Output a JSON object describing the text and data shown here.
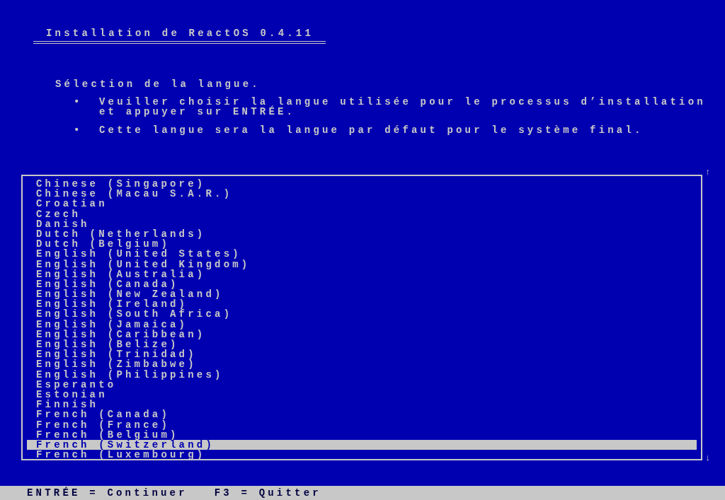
{
  "title": "Installation de ReactOS 0.4.11",
  "heading": "Sélection de la langue.",
  "bullets": [
    {
      "marker": "•",
      "text": "Veuiller choisir la langue utilisée pour le processus d’installation et appuyer sur ENTRÉE."
    },
    {
      "marker": "•",
      "text": "Cette langue sera la langue par défaut pour le système final."
    }
  ],
  "scroll_up": "↑",
  "scroll_down": "↓",
  "languages": [
    {
      "label": "Chinese (Singapore)",
      "selected": false
    },
    {
      "label": "Chinese (Macau S.A.R.)",
      "selected": false
    },
    {
      "label": "Croatian",
      "selected": false
    },
    {
      "label": "Czech",
      "selected": false
    },
    {
      "label": "Danish",
      "selected": false
    },
    {
      "label": "Dutch (Netherlands)",
      "selected": false
    },
    {
      "label": "Dutch (Belgium)",
      "selected": false
    },
    {
      "label": "English (United States)",
      "selected": false
    },
    {
      "label": "English (United Kingdom)",
      "selected": false
    },
    {
      "label": "English (Australia)",
      "selected": false
    },
    {
      "label": "English (Canada)",
      "selected": false
    },
    {
      "label": "English (New Zealand)",
      "selected": false
    },
    {
      "label": "English (Ireland)",
      "selected": false
    },
    {
      "label": "English (South Africa)",
      "selected": false
    },
    {
      "label": "English (Jamaica)",
      "selected": false
    },
    {
      "label": "English (Caribbean)",
      "selected": false
    },
    {
      "label": "English (Belize)",
      "selected": false
    },
    {
      "label": "English (Trinidad)",
      "selected": false
    },
    {
      "label": "English (Zimbabwe)",
      "selected": false
    },
    {
      "label": "English (Philippines)",
      "selected": false
    },
    {
      "label": "Esperanto",
      "selected": false
    },
    {
      "label": "Estonian",
      "selected": false
    },
    {
      "label": "Finnish",
      "selected": false
    },
    {
      "label": "French (Canada)",
      "selected": false
    },
    {
      "label": "French (France)",
      "selected": false
    },
    {
      "label": "French (Belgium)",
      "selected": false
    },
    {
      "label": "French (Switzerland)",
      "selected": true
    },
    {
      "label": "French (Luxembourg)",
      "selected": false
    }
  ],
  "status_bar": "ENTRÉE = Continuer   F3 = Quitter"
}
